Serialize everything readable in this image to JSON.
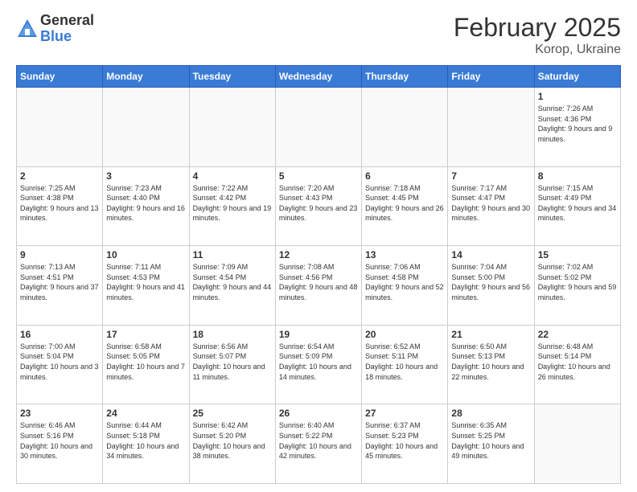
{
  "logo": {
    "general": "General",
    "blue": "Blue"
  },
  "title": "February 2025",
  "location": "Korop, Ukraine",
  "days_of_week": [
    "Sunday",
    "Monday",
    "Tuesday",
    "Wednesday",
    "Thursday",
    "Friday",
    "Saturday"
  ],
  "weeks": [
    [
      {
        "day": "",
        "info": ""
      },
      {
        "day": "",
        "info": ""
      },
      {
        "day": "",
        "info": ""
      },
      {
        "day": "",
        "info": ""
      },
      {
        "day": "",
        "info": ""
      },
      {
        "day": "",
        "info": ""
      },
      {
        "day": "1",
        "info": "Sunrise: 7:26 AM\nSunset: 4:36 PM\nDaylight: 9 hours and 9 minutes."
      }
    ],
    [
      {
        "day": "2",
        "info": "Sunrise: 7:25 AM\nSunset: 4:38 PM\nDaylight: 9 hours and 13 minutes."
      },
      {
        "day": "3",
        "info": "Sunrise: 7:23 AM\nSunset: 4:40 PM\nDaylight: 9 hours and 16 minutes."
      },
      {
        "day": "4",
        "info": "Sunrise: 7:22 AM\nSunset: 4:42 PM\nDaylight: 9 hours and 19 minutes."
      },
      {
        "day": "5",
        "info": "Sunrise: 7:20 AM\nSunset: 4:43 PM\nDaylight: 9 hours and 23 minutes."
      },
      {
        "day": "6",
        "info": "Sunrise: 7:18 AM\nSunset: 4:45 PM\nDaylight: 9 hours and 26 minutes."
      },
      {
        "day": "7",
        "info": "Sunrise: 7:17 AM\nSunset: 4:47 PM\nDaylight: 9 hours and 30 minutes."
      },
      {
        "day": "8",
        "info": "Sunrise: 7:15 AM\nSunset: 4:49 PM\nDaylight: 9 hours and 34 minutes."
      }
    ],
    [
      {
        "day": "9",
        "info": "Sunrise: 7:13 AM\nSunset: 4:51 PM\nDaylight: 9 hours and 37 minutes."
      },
      {
        "day": "10",
        "info": "Sunrise: 7:11 AM\nSunset: 4:53 PM\nDaylight: 9 hours and 41 minutes."
      },
      {
        "day": "11",
        "info": "Sunrise: 7:09 AM\nSunset: 4:54 PM\nDaylight: 9 hours and 44 minutes."
      },
      {
        "day": "12",
        "info": "Sunrise: 7:08 AM\nSunset: 4:56 PM\nDaylight: 9 hours and 48 minutes."
      },
      {
        "day": "13",
        "info": "Sunrise: 7:06 AM\nSunset: 4:58 PM\nDaylight: 9 hours and 52 minutes."
      },
      {
        "day": "14",
        "info": "Sunrise: 7:04 AM\nSunset: 5:00 PM\nDaylight: 9 hours and 56 minutes."
      },
      {
        "day": "15",
        "info": "Sunrise: 7:02 AM\nSunset: 5:02 PM\nDaylight: 9 hours and 59 minutes."
      }
    ],
    [
      {
        "day": "16",
        "info": "Sunrise: 7:00 AM\nSunset: 5:04 PM\nDaylight: 10 hours and 3 minutes."
      },
      {
        "day": "17",
        "info": "Sunrise: 6:58 AM\nSunset: 5:05 PM\nDaylight: 10 hours and 7 minutes."
      },
      {
        "day": "18",
        "info": "Sunrise: 6:56 AM\nSunset: 5:07 PM\nDaylight: 10 hours and 11 minutes."
      },
      {
        "day": "19",
        "info": "Sunrise: 6:54 AM\nSunset: 5:09 PM\nDaylight: 10 hours and 14 minutes."
      },
      {
        "day": "20",
        "info": "Sunrise: 6:52 AM\nSunset: 5:11 PM\nDaylight: 10 hours and 18 minutes."
      },
      {
        "day": "21",
        "info": "Sunrise: 6:50 AM\nSunset: 5:13 PM\nDaylight: 10 hours and 22 minutes."
      },
      {
        "day": "22",
        "info": "Sunrise: 6:48 AM\nSunset: 5:14 PM\nDaylight: 10 hours and 26 minutes."
      }
    ],
    [
      {
        "day": "23",
        "info": "Sunrise: 6:46 AM\nSunset: 5:16 PM\nDaylight: 10 hours and 30 minutes."
      },
      {
        "day": "24",
        "info": "Sunrise: 6:44 AM\nSunset: 5:18 PM\nDaylight: 10 hours and 34 minutes."
      },
      {
        "day": "25",
        "info": "Sunrise: 6:42 AM\nSunset: 5:20 PM\nDaylight: 10 hours and 38 minutes."
      },
      {
        "day": "26",
        "info": "Sunrise: 6:40 AM\nSunset: 5:22 PM\nDaylight: 10 hours and 42 minutes."
      },
      {
        "day": "27",
        "info": "Sunrise: 6:37 AM\nSunset: 5:23 PM\nDaylight: 10 hours and 45 minutes."
      },
      {
        "day": "28",
        "info": "Sunrise: 6:35 AM\nSunset: 5:25 PM\nDaylight: 10 hours and 49 minutes."
      },
      {
        "day": "",
        "info": ""
      }
    ]
  ]
}
